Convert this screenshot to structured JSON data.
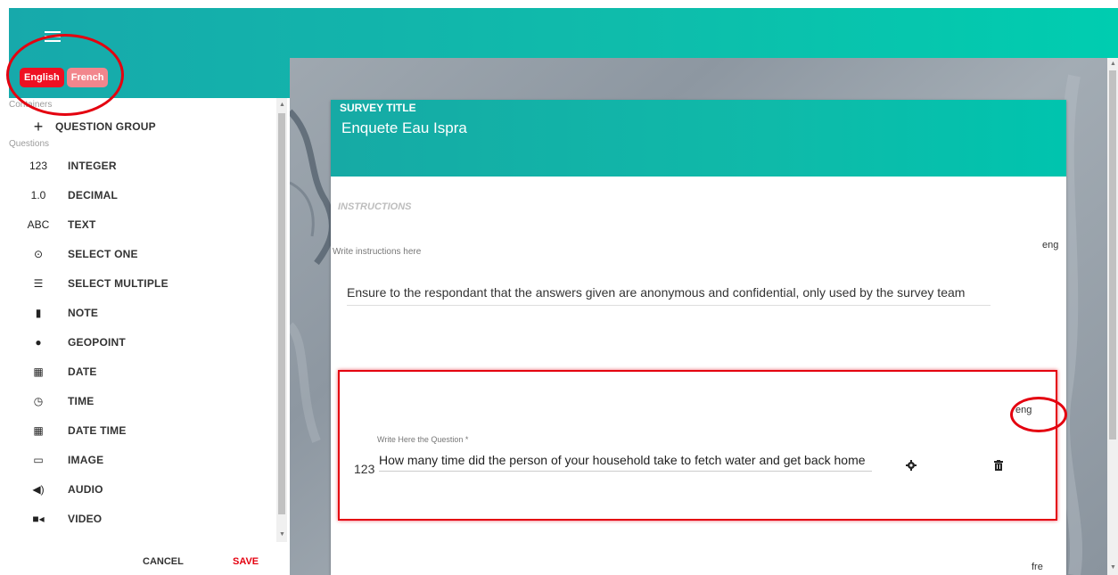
{
  "header": {
    "menu_icon": "hamburger-menu-icon"
  },
  "languages": [
    {
      "label": "English",
      "active": true,
      "color": "#ee1022"
    },
    {
      "label": "French",
      "active": false,
      "color": "#f2868d"
    }
  ],
  "palette": {
    "containers_label": "Containers",
    "question_group": {
      "icon": "+",
      "label": "QUESTION GROUP"
    },
    "questions_label": "Questions",
    "items": [
      {
        "icon": "123",
        "label": "INTEGER"
      },
      {
        "icon": "1.0",
        "label": "DECIMAL"
      },
      {
        "icon": "ABC",
        "label": "TEXT"
      },
      {
        "icon": "⊙",
        "label": "SELECT ONE"
      },
      {
        "icon": "☰",
        "label": "SELECT MULTIPLE"
      },
      {
        "icon": "▮",
        "label": "NOTE"
      },
      {
        "icon": "●",
        "label": "GEOPOINT"
      },
      {
        "icon": "▦",
        "label": "DATE"
      },
      {
        "icon": "◷",
        "label": "TIME"
      },
      {
        "icon": "▦",
        "label": "DATE TIME"
      },
      {
        "icon": "▭",
        "label": "IMAGE"
      },
      {
        "icon": "◀)",
        "label": "AUDIO"
      },
      {
        "icon": "■◂",
        "label": "VIDEO"
      }
    ]
  },
  "footer": {
    "cancel_label": "CANCEL",
    "save_label": "SAVE"
  },
  "survey": {
    "title_label": "SURVEY TITLE",
    "title": "Enquete Eau Ispra",
    "instructions_label": "INSTRUCTIONS",
    "instructions_hint": "Write instructions here",
    "instructions_lang": "eng",
    "instructions_text": "Ensure to the respondant that the answers given are anonymous and confidential, only used by the survey team",
    "question": {
      "lang": "eng",
      "hint": "Write Here the Question *",
      "type_label": "123",
      "text": "How many time did the person of your household take to fetch water and get back home"
    },
    "next_lang": "fre"
  },
  "colors": {
    "accent_red": "#e4000f",
    "teal": "#16aaa5"
  }
}
